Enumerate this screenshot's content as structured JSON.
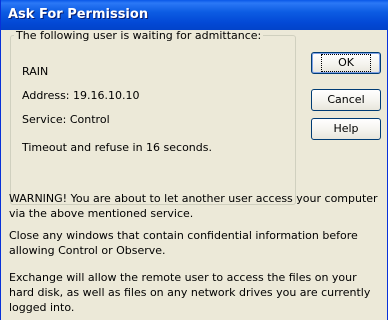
{
  "window": {
    "title": "Ask For Permission"
  },
  "group": {
    "legend": "The following user is waiting for admittance:",
    "user": "RAIN",
    "address": "Address: 19.16.10.10",
    "service": "Service: Control",
    "timeout": "Timeout and  refuse in 16 seconds."
  },
  "buttons": {
    "ok": "OK",
    "cancel": "Cancel",
    "help": "Help"
  },
  "messages": {
    "warning_line1": "WARNING!  You are about to let another user access your computer",
    "warning_line2": "via the above mentioned service.",
    "close_line1": "Close any windows that contain confidential information before",
    "close_line2": "allowing Control or Observe.",
    "exchange_line1": "Exchange will allow the remote user to access the files on your",
    "exchange_line2": "hard disk, as well as files on any network drives you are currently",
    "exchange_line3": "logged into."
  }
}
